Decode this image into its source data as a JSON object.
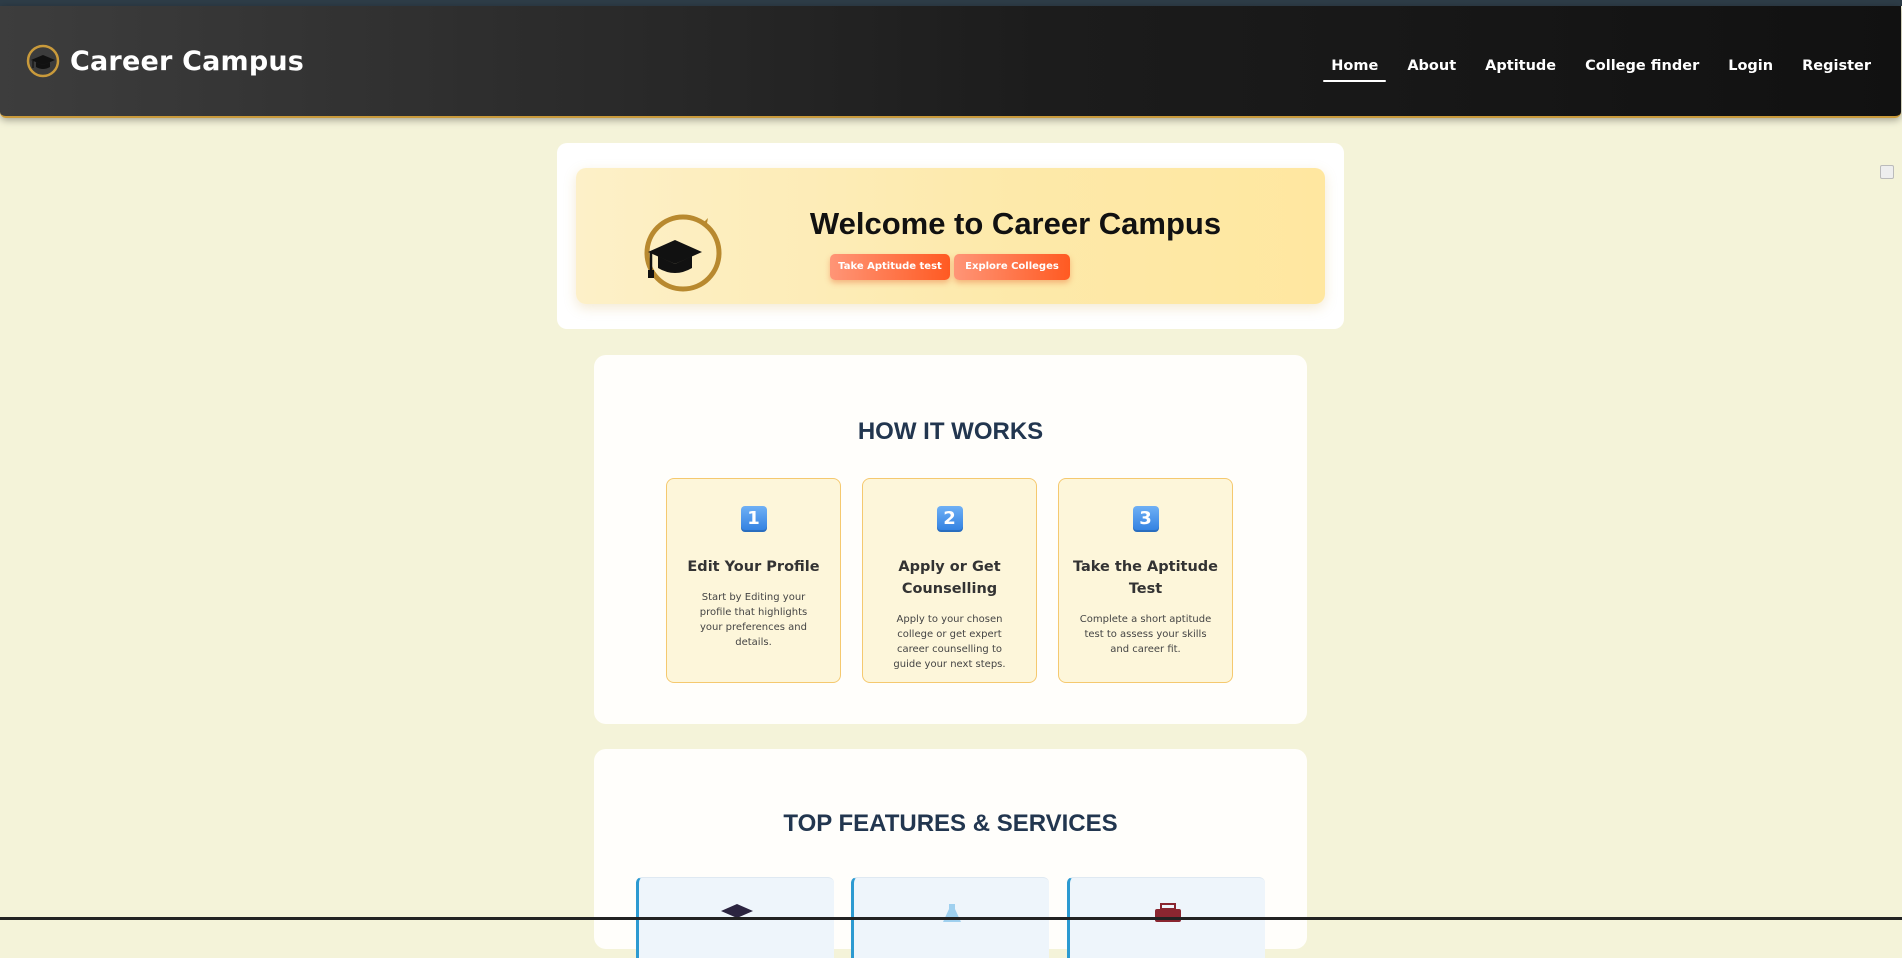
{
  "brand": {
    "title": "Career Campus",
    "logo_icon": "graduation-cap-compass-icon"
  },
  "nav": {
    "items": [
      {
        "label": "Home",
        "active": true
      },
      {
        "label": "About",
        "active": false
      },
      {
        "label": "Aptitude",
        "active": false
      },
      {
        "label": "College finder",
        "active": false
      },
      {
        "label": "Login",
        "active": false
      },
      {
        "label": "Register",
        "active": false
      }
    ]
  },
  "hero": {
    "title": "Welcome to Career Campus",
    "buttons": {
      "aptitude": "Take Aptitude test",
      "colleges": "Explore Colleges"
    }
  },
  "how_it_works": {
    "heading": "HOW IT WORKS",
    "steps": [
      {
        "number": "1",
        "title": "Edit Your Profile",
        "description": "Start by Editing your profile that highlights your preferences and details."
      },
      {
        "number": "2",
        "title": "Apply or Get Counselling",
        "description": "Apply to your chosen college or get expert career counselling to guide your next steps."
      },
      {
        "number": "3",
        "title": "Take the Aptitude Test",
        "description": "Complete a short aptitude test to assess your skills and career fit."
      }
    ]
  },
  "features": {
    "heading": "TOP FEATURES & SERVICES",
    "cards": [
      {
        "icon": "graduation-cap-icon"
      },
      {
        "icon": "flask-icon"
      },
      {
        "icon": "briefcase-icon"
      }
    ]
  },
  "colors": {
    "page_bg": "#f4f3d9",
    "navbar_bg": "#1c1c1c",
    "accent_gold": "#c99a3b",
    "button_orange": "#ff5a22",
    "heading_navy": "#22364f",
    "step_badge_blue": "#2f7fe0"
  }
}
